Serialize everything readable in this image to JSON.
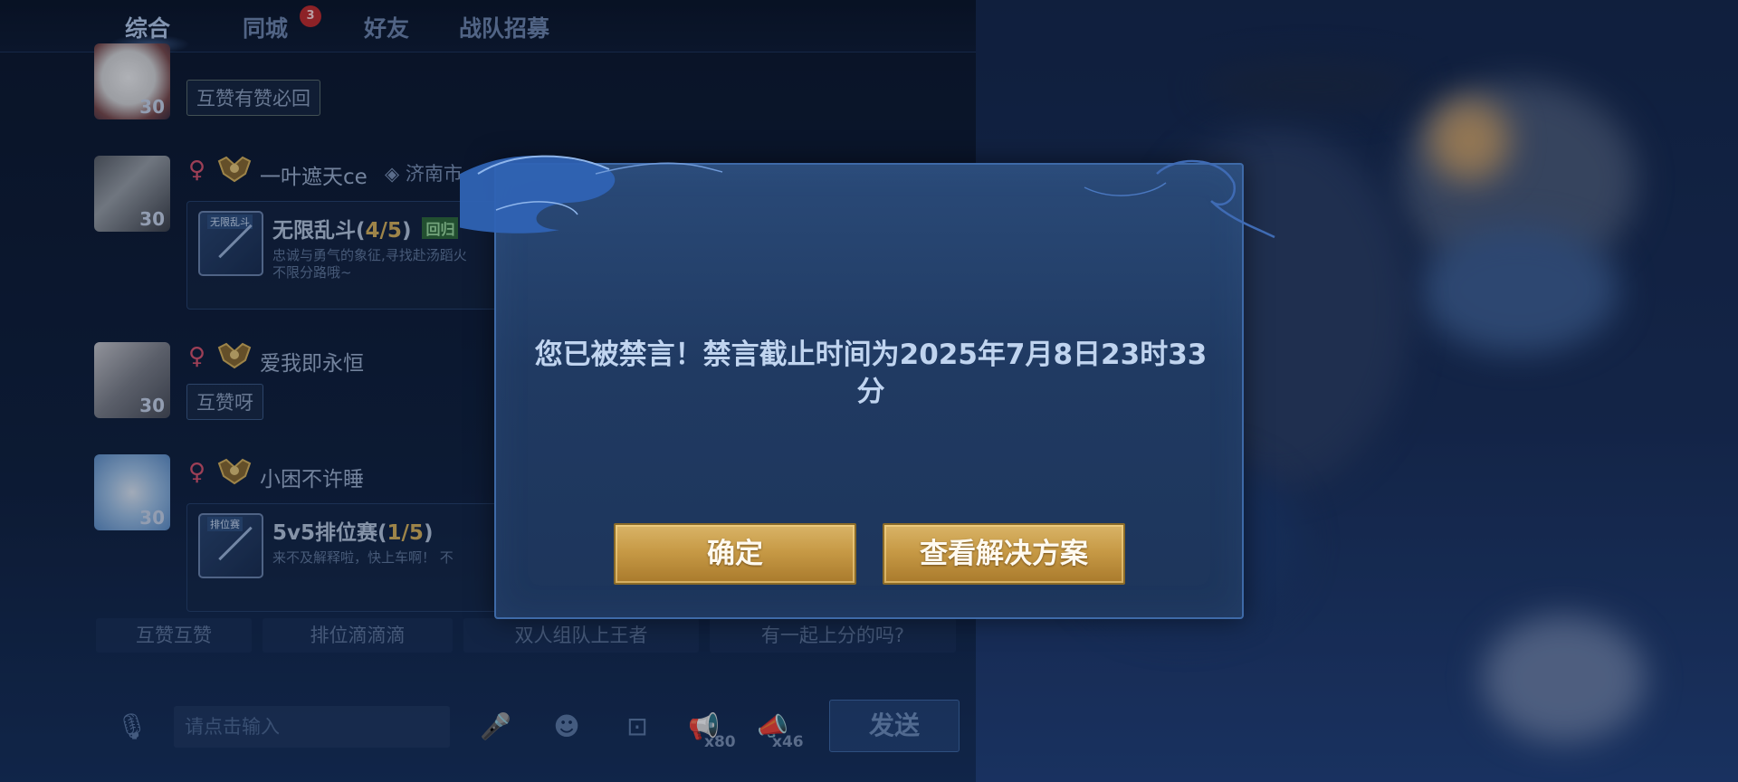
{
  "tabs": [
    {
      "label": "综合",
      "active": true
    },
    {
      "label": "同城",
      "badge": "3"
    },
    {
      "label": "好友"
    },
    {
      "label": "战队招募"
    }
  ],
  "messages": [
    {
      "level": "30",
      "bubble": "互赞有赞必回"
    },
    {
      "gender": "♀",
      "name": "一叶遮天ce",
      "location": "济南市",
      "level": "30",
      "card": {
        "tag": "无限乱斗",
        "title": "无限乱斗",
        "count_open": "(",
        "count": "4/5",
        "count_close": ")",
        "badge": "回归",
        "desc_line1": "忠诚与勇气的象征,寻找赴汤蹈火",
        "desc_line2": "不限分路哦~"
      }
    },
    {
      "gender": "♀",
      "name": "爱我即永恒",
      "level": "30",
      "bubble": "互赞呀"
    },
    {
      "gender": "♀",
      "name": "小困不许睡",
      "level": "30",
      "card": {
        "tag": "排位赛",
        "title": "5v5排位赛",
        "count_open": "(",
        "count": "1/5",
        "count_close": ")",
        "desc_line1": "来不及解释啦，快上车啊！ 不"
      }
    }
  ],
  "quick_replies": [
    "互赞互赞",
    "排位滴滴滴",
    "双人组队上王者",
    "有一起上分的吗?"
  ],
  "input_bar": {
    "placeholder": "请点击输入",
    "horn_small_count": "x80",
    "horn_big_count": "x46",
    "send_label": "发送"
  },
  "dialog": {
    "message_line1": "您已被禁言！禁言截止时间为2025年7月8日23时33",
    "message_line2": "分",
    "confirm_label": "确定",
    "solution_label": "查看解决方案"
  },
  "colors": {
    "accent_gold": "#c79a46",
    "dialog_bg": "#203a62",
    "female_icon": "#d8546d"
  }
}
